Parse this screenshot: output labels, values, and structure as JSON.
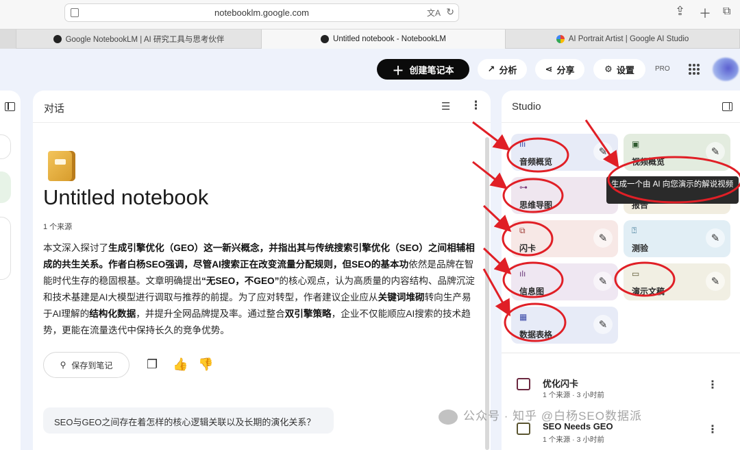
{
  "browser": {
    "url": "notebooklm.google.com",
    "tabs": [
      {
        "title": "Google NotebookLM | AI 研究工具与思考伙伴"
      },
      {
        "title": "Untitled notebook - NotebookLM"
      },
      {
        "title": "AI Portrait Artist | Google AI Studio"
      }
    ]
  },
  "header": {
    "create_label": "创建笔记本",
    "analyze_label": "分析",
    "share_label": "分享",
    "settings_label": "设置",
    "pro_badge": "PRO"
  },
  "chat": {
    "panel_title": "对话",
    "notebook_title": "Untitled notebook",
    "source_count": "1 个来源",
    "summary": {
      "s1": "本文深入探讨了",
      "b1": "生成引擎优化（GEO）这一新兴概念，并指出其与传统搜索引擎优化（SEO）之间相辅相成的共生关系。作者白杨SEO强调，尽管AI搜索正在改变流量分配规则，但SEO的基本功",
      "s2": "依然是品牌在智能时代生存的稳固根基。文章明确提出",
      "b2": "“无SEO，不GEO”",
      "s3": "的核心观点，认为高质量的内容结构、品牌沉淀和技术基建是AI大模型进行调取与推荐的前提。为了应对转型，作者建议企业应从",
      "b3": "关键词堆砌",
      "s4": "转向生产易于AI理解的",
      "b4": "结构化数据",
      "s5": "，并提升全网品牌提及率。通过整合",
      "b5": "双引擎策略",
      "s6": "，企业不仅能顺应AI搜索的技术趋势，更能在流量迭代中保持长久的竞争优势。"
    },
    "save_note_label": "保存到笔记",
    "question": "SEO与GEO之间存在着怎样的核心逻辑关联以及长期的演化关系？"
  },
  "studio": {
    "panel_title": "Studio",
    "tools": [
      {
        "label": "音频概览",
        "icon": "audio-waveform-icon",
        "color": "#e7ebf7"
      },
      {
        "label": "视频概览",
        "icon": "video-icon",
        "color": "#e3ecdf"
      },
      {
        "label": "思维导图",
        "icon": "mindmap-icon",
        "color": "#efe6ef"
      },
      {
        "label": "报告",
        "icon": "report-icon",
        "color": "#f1ede0"
      },
      {
        "label": "闪卡",
        "icon": "flashcard-icon",
        "color": "#f7e8e6"
      },
      {
        "label": "测验",
        "icon": "quiz-icon",
        "color": "#e1eef5"
      },
      {
        "label": "信息图",
        "icon": "infographic-icon",
        "color": "#efe7f2"
      },
      {
        "label": "演示文稿",
        "icon": "slides-icon",
        "color": "#f1efe3"
      },
      {
        "label": "数据表格",
        "icon": "table-icon",
        "color": "#e7ebf7"
      }
    ],
    "tooltip": "生成一个由 AI 向您演示的解说视频",
    "saved": [
      {
        "name": "优化闪卡",
        "meta": "1 个来源 · 3 小时前"
      },
      {
        "name": "SEO Needs GEO",
        "meta": "1 个来源 · 3 小时前"
      }
    ]
  },
  "watermark": "公众号 · 知乎 @白杨SEO数据派",
  "colors": {
    "accent": "#0b0b0b",
    "annotation": "#e01f26",
    "background": "#eef2fb"
  }
}
